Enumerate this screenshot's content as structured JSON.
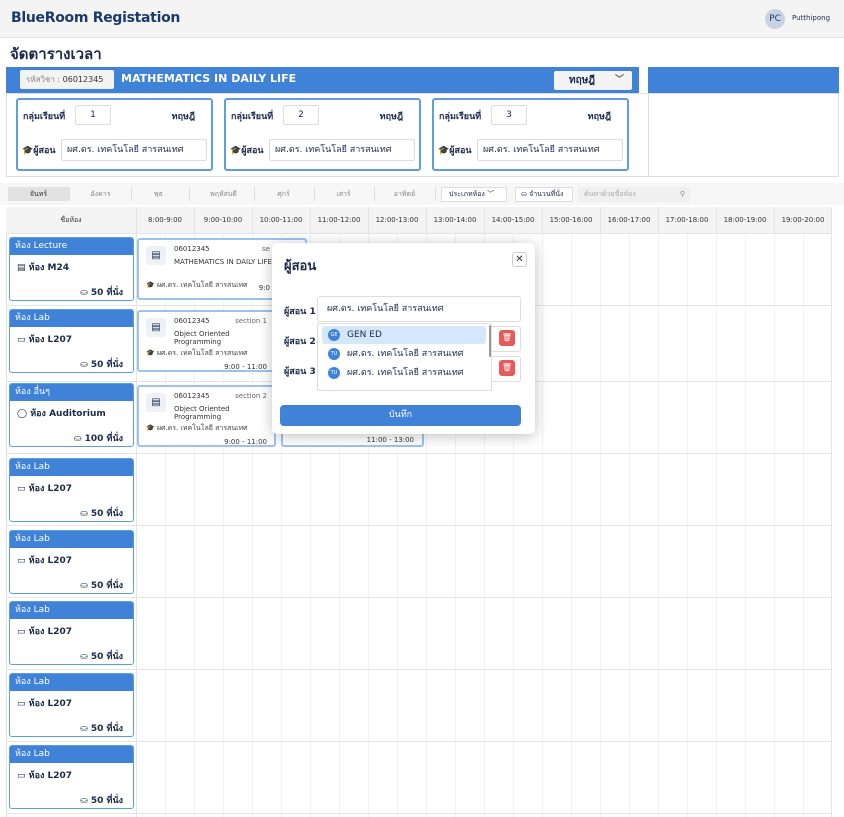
{
  "app": {
    "brand": "BlueRoom Registation",
    "user_initials": "PC",
    "user_name": "Putthipong"
  },
  "page": {
    "title": "จัดตารางเวลา"
  },
  "course": {
    "code_label": "รหัสวิชา :",
    "code": "06012345",
    "name": "MATHEMATICS IN DAILY LIFE",
    "term": "ทฤษฎี",
    "groups": [
      {
        "label": "กลุ่มเรียนที่",
        "number": "1",
        "type": "ทฤษฎี",
        "teacher_label": "ผู้สอน",
        "teacher": "ผศ.ดร. เทคโนโลยี สารสนเทศ"
      },
      {
        "label": "กลุ่มเรียนที่",
        "number": "2",
        "type": "ทฤษฎี",
        "teacher_label": "ผู้สอน",
        "teacher": "ผศ.ดร. เทคโนโลยี สารสนเทศ"
      },
      {
        "label": "กลุ่มเรียนที่",
        "number": "3",
        "type": "ทฤษฎี",
        "teacher_label": "ผู้สอน",
        "teacher": "ผศ.ดร. เทคโนโลยี สารสนเทศ"
      }
    ]
  },
  "filters": {
    "days": [
      "จันทร์",
      "อังคาร",
      "พุธ",
      "พฤหัสบดี",
      "ศุกร์",
      "เสาร์",
      "อาทิตย์"
    ],
    "room_type": "ประเภทห้อง",
    "seats": "จำนวนที่นั่ง",
    "search_placeholder": "ค้นหาด้วยชื่อห้อง"
  },
  "grid": {
    "room_header": "ชื่อห้อง",
    "times": [
      "8:00-9:00",
      "9:00-10:00",
      "10:00-11:00",
      "11:00-12:00",
      "12:00-13:00",
      "13:00-14:00",
      "14:00-15:00",
      "15:00-16:00",
      "16:00-17:00",
      "17:00-18:00",
      "18:00-19:00",
      "19:00-20:00"
    ],
    "rooms": [
      {
        "type": "ห้อง Lecture",
        "name": "ห้อง M24",
        "seats": "50 ที่นั่ง",
        "icon": "book-icon"
      },
      {
        "type": "ห้อง Lab",
        "name": "ห้อง L207",
        "seats": "50 ที่นั่ง",
        "icon": "monitor-icon"
      },
      {
        "type": "ห้อง อื่นๆ",
        "name": "ห้อง Auditorium",
        "seats": "100 ที่นั่ง",
        "icon": "circle-icon"
      },
      {
        "type": "ห้อง Lab",
        "name": "ห้อง L207",
        "seats": "50 ที่นั่ง",
        "icon": "monitor-icon"
      },
      {
        "type": "ห้อง Lab",
        "name": "ห้อง L207",
        "seats": "50 ที่นั่ง",
        "icon": "monitor-icon"
      },
      {
        "type": "ห้อง Lab",
        "name": "ห้อง L207",
        "seats": "50 ที่นั่ง",
        "icon": "monitor-icon"
      },
      {
        "type": "ห้อง Lab",
        "name": "ห้อง L207",
        "seats": "50 ที่นั่ง",
        "icon": "monitor-icon"
      },
      {
        "type": "ห้อง Lab",
        "name": "ห้อง L207",
        "seats": "50 ที่นั่ง",
        "icon": "monitor-icon"
      }
    ],
    "classes": [
      {
        "code": "06012345",
        "section": "se",
        "name": "MATHEMATICS IN DAILY LIFE",
        "teacher": "ผศ.ดร. เทคโนโลยี สารสนเทศ",
        "time": "9:0"
      },
      {
        "code": "06012345",
        "section": "section 1",
        "name": "Object Oriented Programming",
        "teacher": "ผศ.ดร. เทคโนโลยี สารสนเทศ",
        "time": "9:00 - 11:00"
      },
      {
        "code": "06012345",
        "section": "section 2",
        "name": "Object Oriented Programming",
        "teacher": "ผศ.ดร. เทคโนโลยี สารสนเทศ",
        "time": "9:00 - 11:00"
      }
    ],
    "partial_time": "11:00 - 13:00"
  },
  "modal": {
    "title": "ผู้สอน",
    "labels": [
      "ผู้สอน 1",
      "ผู้สอน 2",
      "ผู้สอน 3"
    ],
    "teacher1": "ผศ.ดร. เทคโนโลยี สารสนเทศ",
    "options": [
      {
        "badge": "GE",
        "label": "GEN ED"
      },
      {
        "badge": "TU",
        "label": "ผศ.ดร. เทคโนโลยี สารสนเทศ"
      },
      {
        "badge": "TU",
        "label": "ผศ.ดร. เทคโนโลยี สารสนเทศ"
      }
    ],
    "save": "บันทึก"
  }
}
